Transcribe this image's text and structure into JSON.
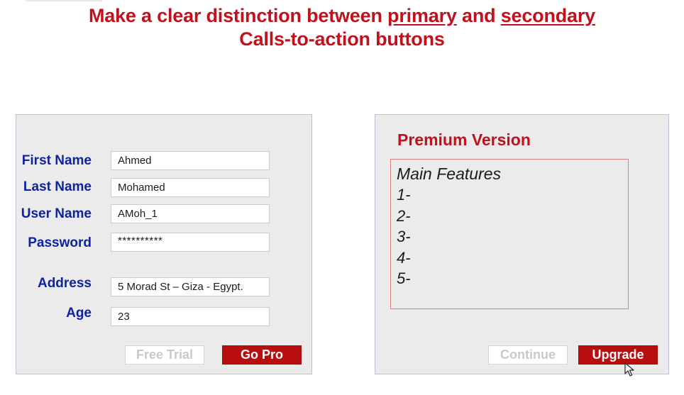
{
  "header": {
    "line1_prefix": "Make a clear distinction between ",
    "line1_primary": "primary",
    "line1_mid": " and ",
    "line1_secondary": "secondary",
    "line2": "Calls-to-action buttons"
  },
  "form": {
    "fields": [
      {
        "label": "First Name",
        "value": "Ahmed"
      },
      {
        "label": "Last Name",
        "value": "Mohamed"
      },
      {
        "label": "User Name",
        "value": "AMoh_1"
      },
      {
        "label": "Password",
        "value": "**********"
      },
      {
        "label": "Address",
        "value": "5 Morad St – Giza - Egypt."
      },
      {
        "label": "Age",
        "value": "23"
      }
    ],
    "secondary_button": "Free Trial",
    "primary_button": "Go Pro"
  },
  "premium": {
    "title": "Premium Version",
    "features_heading": "Main Features",
    "features": [
      "1-",
      "2-",
      "3-",
      "4-",
      "5-"
    ],
    "secondary_button": "Continue",
    "primary_button": "Upgrade"
  },
  "colors": {
    "accent_red": "#c0111c",
    "primary_button": "#b80e0e",
    "label_blue": "#0f23a0",
    "panel_bg": "#ebebeb"
  },
  "icons": {
    "cursor": "mouse-pointer-icon"
  }
}
